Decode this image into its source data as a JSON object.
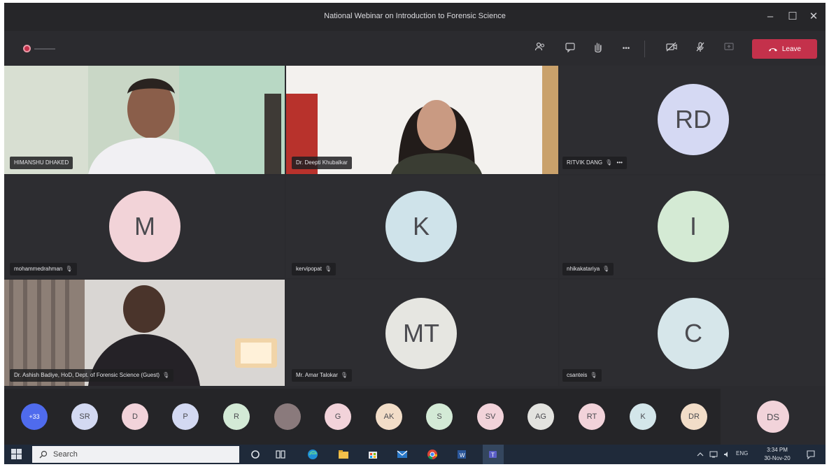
{
  "window": {
    "title": "National Webinar on Introduction to Forensic Science",
    "controls": {
      "minimize": "–",
      "maximize": "☐",
      "close": "✕"
    }
  },
  "toolbar": {
    "leave_label": "Leave",
    "more_label": "•••"
  },
  "tiles": [
    {
      "name": "HIMANSHU DHAKED",
      "type": "video"
    },
    {
      "name": "Dr. Deepti Khubalkar",
      "type": "video"
    },
    {
      "name": "RITVIK DANG",
      "initials": "RD",
      "type": "avatar",
      "color": "#d5d9f3",
      "extra": "•••"
    },
    {
      "name": "mohammedrahman",
      "initials": "M",
      "type": "avatar",
      "color": "#f2d3d8"
    },
    {
      "name": "kervipopat",
      "initials": "K",
      "type": "avatar",
      "color": "#cfe3ea"
    },
    {
      "name": "nhikakatariya",
      "initials": "I",
      "type": "avatar",
      "color": "#d4ead4"
    },
    {
      "name": "Dr. Ashish Badiye, HoD, Dept. of Forensic Science (Guest)",
      "type": "video"
    },
    {
      "name": "Mr. Amar Talokar",
      "initials": "MT",
      "type": "avatar",
      "color": "#e6e6e1"
    },
    {
      "name": "csanteis",
      "initials": "C",
      "type": "avatar",
      "color": "#d6e6ea"
    }
  ],
  "strip": {
    "more_count": "+33",
    "participants": [
      {
        "initials": "SR",
        "color": "#d3d9f2"
      },
      {
        "initials": "D",
        "color": "#f2d3da"
      },
      {
        "initials": "P",
        "color": "#d3d9f2"
      },
      {
        "initials": "R",
        "color": "#d3ead6"
      },
      {
        "initials": "",
        "color": "#8a7a7c"
      },
      {
        "initials": "G",
        "color": "#f2d3da"
      },
      {
        "initials": "AK",
        "color": "#f2ddc8"
      },
      {
        "initials": "S",
        "color": "#d3ead6"
      },
      {
        "initials": "SV",
        "color": "#f2d3da"
      },
      {
        "initials": "AG",
        "color": "#e3e3df"
      },
      {
        "initials": "RT",
        "color": "#f2d3da"
      },
      {
        "initials": "K",
        "color": "#d3e6ea"
      },
      {
        "initials": "DR",
        "color": "#f2ddc8"
      },
      {
        "initials": "DS",
        "color": "#f2d3da"
      }
    ]
  },
  "taskbar": {
    "search_placeholder": "Search",
    "language": "ENG",
    "time": "3:34 PM",
    "date": "30-Nov-20"
  },
  "colors": {
    "accent_leave": "#c4314b",
    "more_badge": "#4f6bed",
    "taskbar": "#1f2a3a"
  }
}
